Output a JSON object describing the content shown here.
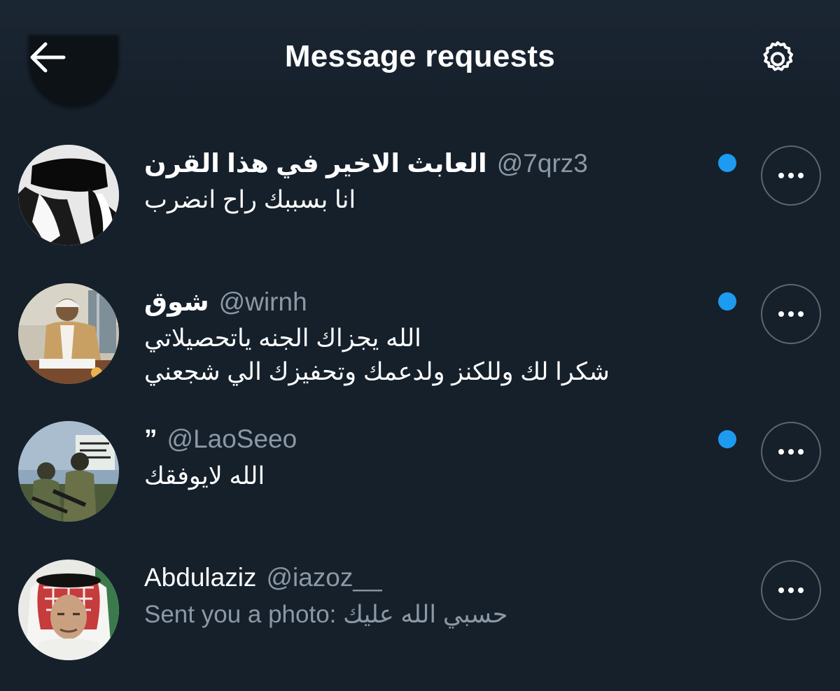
{
  "header": {
    "title": "Message requests",
    "back_icon": "arrow-left-icon",
    "settings_icon": "gear-icon"
  },
  "colors": {
    "background": "#15202b",
    "unread_dot": "#1d9bf0",
    "muted_text": "#8b98a5"
  },
  "requests": [
    {
      "display_name": "العابث الاخير في هذا القرن",
      "handle": "@7qrz3",
      "lines": [
        "انا بسببك راح انضرب"
      ],
      "unread": true
    },
    {
      "display_name": "شوق",
      "handle": "@wirnh",
      "lines": [
        "الله يجزاك الجنه ياتحصيلاتي",
        "شكرا لك وللكنز ولدعمك وتحفيزك الي شجعني"
      ],
      "unread": true
    },
    {
      "display_name": "”",
      "handle": "@LaoSeeo",
      "lines": [
        "الله لايوفقك"
      ],
      "unread": true
    },
    {
      "display_name": "Abdulaziz",
      "handle": "@iazoz__",
      "lines": [
        "Sent you a photo: حسبي الله عليك"
      ],
      "unread": false
    }
  ]
}
